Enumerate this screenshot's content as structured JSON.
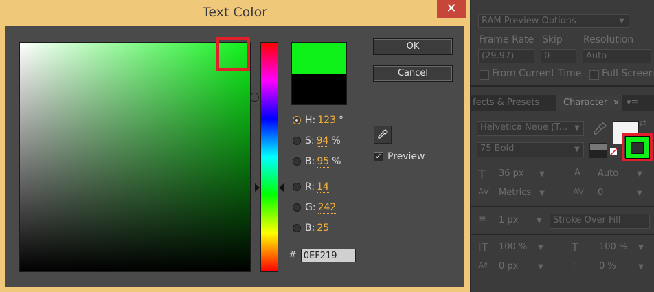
{
  "dialog": {
    "title": "Text Color",
    "close_glyph": "✕",
    "color_new": "#0ef219",
    "color_old": "#000000",
    "hue": {
      "label": "H:",
      "value": "123",
      "unit": "°"
    },
    "saturation": {
      "label": "S:",
      "value": "94",
      "unit": "%"
    },
    "brightness": {
      "label": "B:",
      "value": "95",
      "unit": "%"
    },
    "red": {
      "label": "R:",
      "value": "14"
    },
    "green": {
      "label": "G:",
      "value": "242"
    },
    "blue": {
      "label": "B:",
      "value": "25"
    },
    "hex_label": "#",
    "hex_value": "0EF219",
    "ok_label": "OK",
    "cancel_label": "Cancel",
    "preview_label": "Preview",
    "preview_checked": true,
    "check_glyph": "✓",
    "eyedropper_icon": "eyedropper-icon"
  },
  "preview_panel": {
    "dropdown": "RAM Preview Options",
    "frame_rate_label": "Frame Rate",
    "skip_label": "Skip",
    "resolution_label": "Resolution",
    "frame_rate_value": "(29.97)",
    "skip_value": "0",
    "resolution_value": "Auto",
    "from_current_time_label": "From Current Time",
    "full_screen_label": "Full Screen"
  },
  "tabs": {
    "effects_presets": "fects & Presets",
    "character": "Character",
    "close_glyph": "✕",
    "menu_glyph": "▾≡"
  },
  "character": {
    "font_family": "Helvetica Neue (T...",
    "font_style": "75 Bold",
    "font_size": "36 px",
    "leading": "Auto",
    "kerning": "Metrics",
    "tracking": "0",
    "stroke_width": "1 px",
    "stroke_type": "Stroke Over Fill",
    "vertical_scale": "100 %",
    "horizontal_scale": "100 %",
    "baseline_shift": "0 px",
    "tsume": "0 %",
    "fill_color": "#0ef219",
    "dropdown_glyph": "▼"
  }
}
